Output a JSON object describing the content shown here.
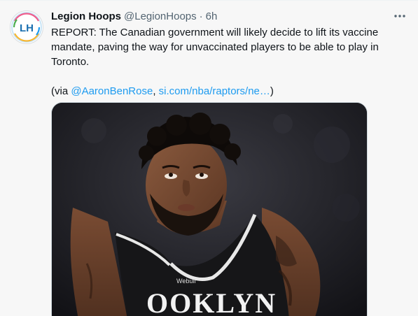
{
  "tweet": {
    "display_name": "Legion Hoops",
    "handle": "@LegionHoops",
    "separator": "·",
    "time": "6h",
    "text_main": "REPORT: The Canadian government will likely decide to lift its vaccine mandate, paving the way for unvaccinated players to be able to play in Toronto.",
    "via_open": "(via ",
    "via_mention": "@AaronBenRose",
    "via_comma": ", ",
    "via_link": "si.com/nba/raptors/ne…",
    "via_close": ")",
    "avatar_letters": "LH",
    "jersey_text": "OOKLYN",
    "jersey_logo": "Webull"
  },
  "colors": {
    "link": "#1d9bf0",
    "text": "#0f1419",
    "secondary": "#536471"
  },
  "icons": {
    "more": "more-horizontal-icon"
  }
}
